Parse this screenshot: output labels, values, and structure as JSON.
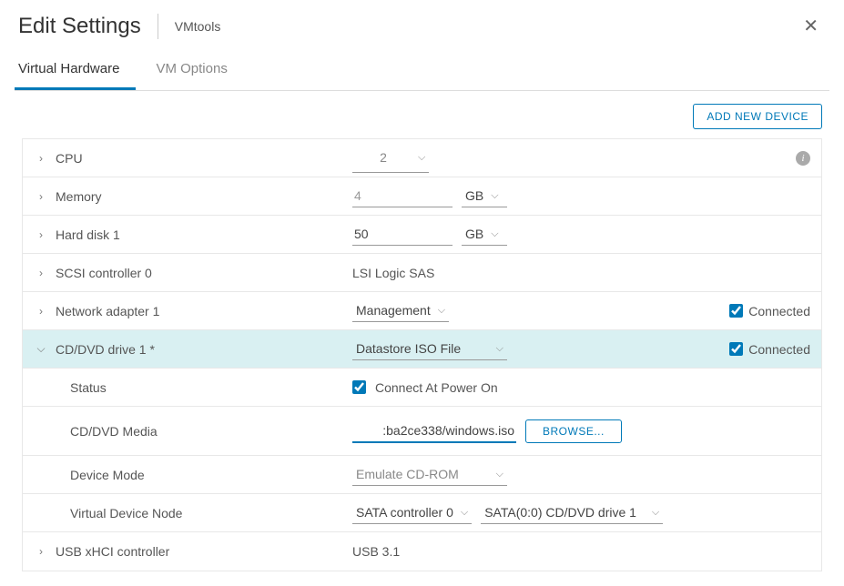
{
  "header": {
    "title": "Edit Settings",
    "vm_name": "VMtools"
  },
  "tabs": {
    "hardware": "Virtual Hardware",
    "options": "VM Options"
  },
  "actions": {
    "add_device": "ADD NEW DEVICE"
  },
  "rows": {
    "cpu": {
      "label": "CPU",
      "value": "2"
    },
    "memory": {
      "label": "Memory",
      "value": "4",
      "unit": "GB"
    },
    "hard_disk": {
      "label": "Hard disk 1",
      "value": "50",
      "unit": "GB"
    },
    "scsi": {
      "label": "SCSI controller 0",
      "value": "LSI Logic SAS"
    },
    "network": {
      "label": "Network adapter 1",
      "value": "Management",
      "connected": "Connected"
    },
    "cddvd": {
      "label": "CD/DVD drive 1 *",
      "value": "Datastore ISO File",
      "connected": "Connected"
    },
    "status": {
      "label": "Status",
      "value": "Connect At Power On"
    },
    "media": {
      "label": "CD/DVD Media",
      "value": ":ba2ce338/windows.iso",
      "browse": "BROWSE..."
    },
    "device_mode": {
      "label": "Device Mode",
      "value": "Emulate CD-ROM"
    },
    "virtual_node": {
      "label": "Virtual Device Node",
      "controller": "SATA controller 0",
      "slot": "SATA(0:0) CD/DVD drive 1"
    },
    "usb": {
      "label": "USB xHCI controller",
      "value": "USB 3.1"
    }
  }
}
